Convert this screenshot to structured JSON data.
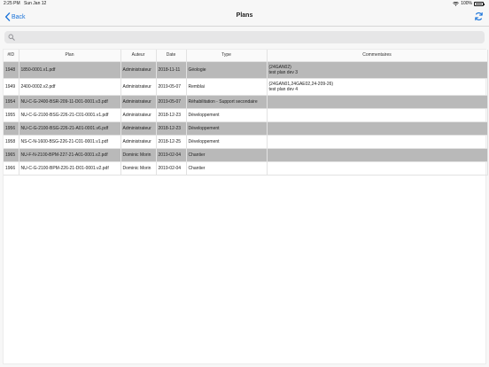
{
  "status_bar": {
    "time": "2:25 PM",
    "date": "Sun Jan 12",
    "battery": "100%"
  },
  "nav": {
    "back_label": "Back",
    "title": "Plans",
    "refresh_icon": "refresh-icon"
  },
  "search": {
    "placeholder": "",
    "value": ""
  },
  "table": {
    "columns": [
      "#ID",
      "Plan",
      "Auteur",
      "Date",
      "Type",
      "Commentaires"
    ],
    "rows": [
      {
        "id": "1948",
        "plan": "1850-0001.v1.pdf",
        "author": "Administrateur",
        "date": "2018-11-11",
        "type": "Géologie",
        "comment_lines": [
          "(24GAN02)",
          "test plan dev 3"
        ],
        "shaded": true,
        "tall": true
      },
      {
        "id": "1949",
        "plan": "2400-0002.v2.pdf",
        "author": "Administrateur",
        "date": "2019-05-07",
        "type": "Remblai",
        "comment_lines": [
          "(24GAN01,24GAE02,24-209-26)",
          "test plan dev 4"
        ],
        "shaded": false,
        "tall": true
      },
      {
        "id": "1954",
        "plan": "NU-C-G-2400-BSR-209-11-D01-0001.v3.pdf",
        "author": "Administrateur",
        "date": "2019-05-07",
        "type": "Réhabilitation - Support secondaire",
        "comment_lines": [],
        "shaded": true,
        "tall": false
      },
      {
        "id": "1955",
        "plan": "NU-C-G-2100-BSG-226-21-C01-0001.v1.pdf",
        "author": "Administrateur",
        "date": "2018-12-23",
        "type": "Développement",
        "comment_lines": [],
        "shaded": false,
        "tall": false
      },
      {
        "id": "1956",
        "plan": "NU-C-G-2100-BSG-226-21-A01-0001.v6.pdf",
        "author": "Administrateur",
        "date": "2018-12-23",
        "type": "Développement",
        "comment_lines": [],
        "shaded": true,
        "tall": false
      },
      {
        "id": "1958",
        "plan": "NS-C-N-1600-BSG-226-21-C01-0001.v1.pdf",
        "author": "Administrateur",
        "date": "2018-12-25",
        "type": "Développement",
        "comment_lines": [],
        "shaded": false,
        "tall": false
      },
      {
        "id": "1965",
        "plan": "NU-F-N-2100-BPM-227-21-A01-0001.v2.pdf",
        "author": "Dominic Morin",
        "date": "2019-02-04",
        "type": "Chantier",
        "comment_lines": [],
        "shaded": true,
        "tall": false
      },
      {
        "id": "1966",
        "plan": "NU-C-G-2100-BPM-226-21-D01-0001.v2.pdf",
        "author": "Dominic Morin",
        "date": "2019-02-04",
        "type": "Chantier",
        "comment_lines": [],
        "shaded": false,
        "tall": false
      }
    ]
  },
  "colors": {
    "accent": "#1a73d9",
    "row_shaded": "#b9b9b9"
  }
}
